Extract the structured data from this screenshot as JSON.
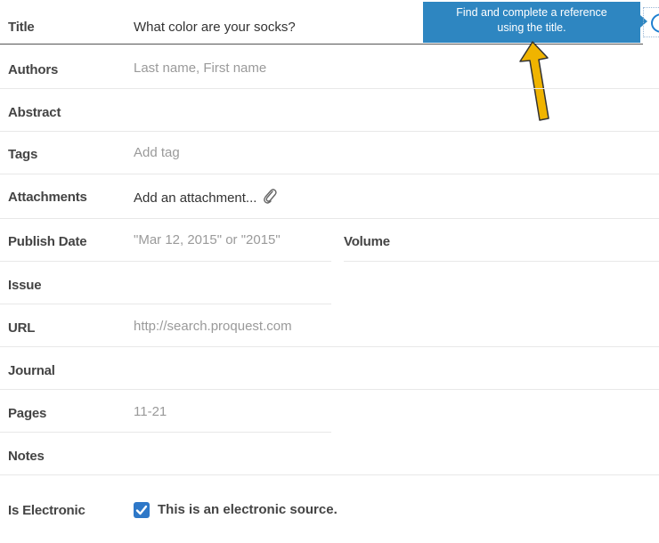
{
  "tooltip": {
    "line1": "Find and complete a reference",
    "line2": "using the title."
  },
  "colors": {
    "tooltip_bg": "#2e86c1",
    "accent_blue": "#1e7fd0",
    "annotation_arrow": "#f0b400"
  },
  "icons": {
    "lookup": "circle-icon",
    "attachment": "paperclip-icon",
    "checkbox": "checkmark-icon",
    "annotation": "arrow-up-icon"
  },
  "fields": {
    "title": {
      "label": "Title",
      "value": "What color are your socks?"
    },
    "authors": {
      "label": "Authors",
      "placeholder": "Last name, First name"
    },
    "abstract": {
      "label": "Abstract",
      "value": ""
    },
    "tags": {
      "label": "Tags",
      "placeholder": "Add tag"
    },
    "attachments": {
      "label": "Attachments",
      "link": "Add an attachment..."
    },
    "publish_date": {
      "label": "Publish Date",
      "placeholder": "\"Mar 12, 2015\" or \"2015\""
    },
    "volume": {
      "label": "Volume",
      "value": ""
    },
    "issue": {
      "label": "Issue",
      "value": ""
    },
    "url": {
      "label": "URL",
      "placeholder": "http://search.proquest.com"
    },
    "journal": {
      "label": "Journal",
      "value": ""
    },
    "pages": {
      "label": "Pages",
      "placeholder": "11-21"
    },
    "notes": {
      "label": "Notes",
      "value": ""
    },
    "is_electronic": {
      "label": "Is Electronic",
      "checkbox_label": "This is an electronic source.",
      "checked": true
    }
  }
}
